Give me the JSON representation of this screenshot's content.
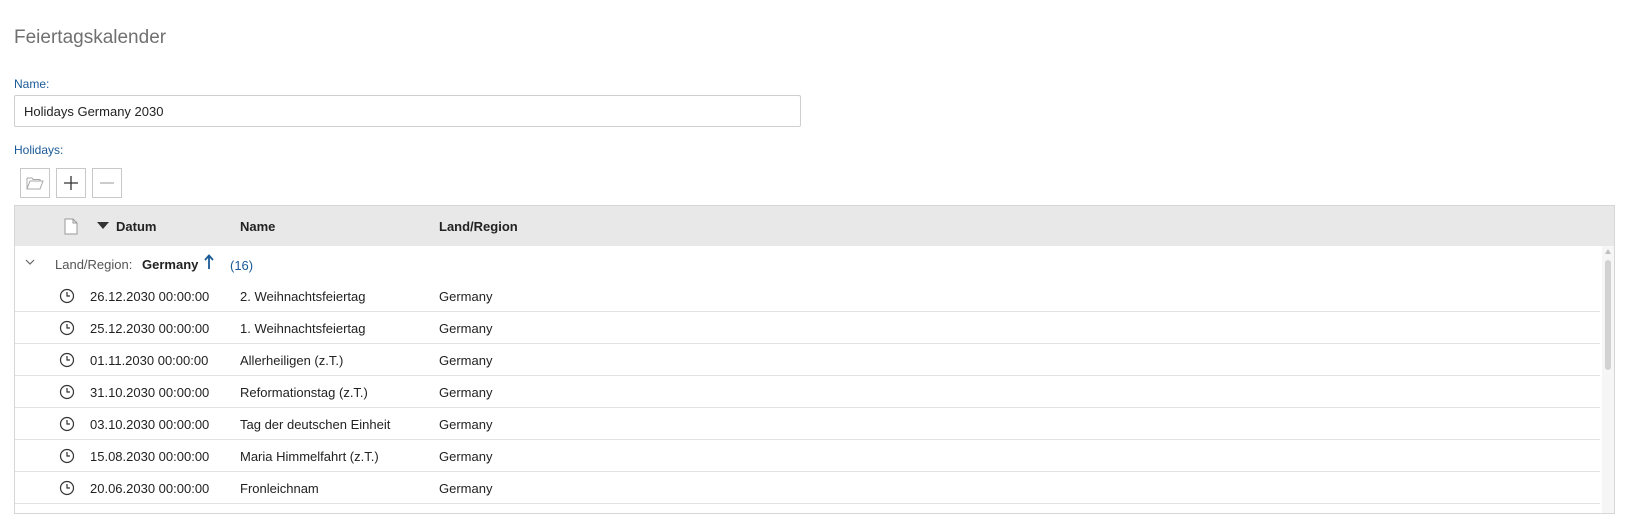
{
  "page": {
    "title": "Feiertagskalender"
  },
  "form": {
    "name_label": "Name:",
    "name_value": "Holidays Germany 2030",
    "holidays_label": "Holidays:"
  },
  "toolbar": {
    "buttons": [
      {
        "icon": "folder-open-icon"
      },
      {
        "icon": "plus-icon"
      },
      {
        "icon": "minus-icon"
      }
    ]
  },
  "grid": {
    "columns": {
      "datum": "Datum",
      "name": "Name",
      "land": "Land/Region"
    },
    "sort": {
      "column": "datum",
      "direction": "descending"
    },
    "group": {
      "label": "Land/Region:",
      "value": "Germany",
      "count": "(16)"
    },
    "rows": [
      {
        "date": "26.12.2030 00:00:00",
        "name": "2. Weihnachtsfeiertag",
        "land": "Germany"
      },
      {
        "date": "25.12.2030 00:00:00",
        "name": "1. Weihnachtsfeiertag",
        "land": "Germany"
      },
      {
        "date": "01.11.2030 00:00:00",
        "name": "Allerheiligen (z.T.)",
        "land": "Germany"
      },
      {
        "date": "31.10.2030 00:00:00",
        "name": "Reformationstag (z.T.)",
        "land": "Germany"
      },
      {
        "date": "03.10.2030 00:00:00",
        "name": "Tag der deutschen Einheit",
        "land": "Germany"
      },
      {
        "date": "15.08.2030 00:00:00",
        "name": "Maria Himmelfahrt (z.T.)",
        "land": "Germany"
      },
      {
        "date": "20.06.2030 00:00:00",
        "name": "Fronleichnam",
        "land": "Germany"
      }
    ]
  },
  "colors": {
    "accent": "#1a5a96",
    "header_bg": "#e8e8e8"
  }
}
